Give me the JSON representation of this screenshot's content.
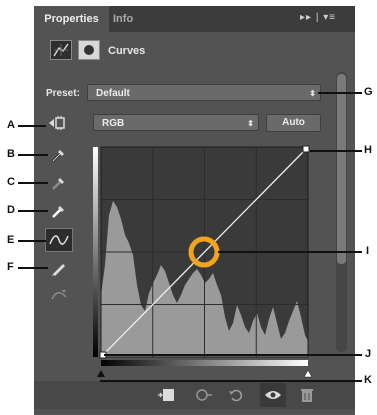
{
  "tabs": [
    {
      "label": "Properties"
    },
    {
      "label": "Info"
    }
  ],
  "panel_menu_glyph": "▸▸ | ▾≡",
  "header": {
    "title": "Curves",
    "icons": [
      "curves-adjustment-icon",
      "layer-mask-icon"
    ]
  },
  "preset": {
    "label": "Preset:",
    "value": "Default"
  },
  "channel": {
    "value": "RGB"
  },
  "auto_label": "Auto",
  "tools": [
    "on-image-adjustment-icon",
    "black-point-eyedropper-icon",
    "gray-point-eyedropper-icon",
    "white-point-eyedropper-icon",
    "point-curve-icon",
    "pencil-icon",
    "smooth-icon"
  ],
  "callouts": {
    "A": "A",
    "B": "B",
    "C": "C",
    "D": "D",
    "E": "E",
    "F": "F",
    "G": "G",
    "H": "H",
    "I": "I",
    "J": "J",
    "K": "K"
  },
  "bottom_icons": [
    "clip-to-layer-icon",
    "view-previous-state-icon",
    "reset-icon",
    "visibility-eye-icon",
    "trash-icon"
  ],
  "colors": {
    "panel": "#535353",
    "histogram": "#9a9a9a",
    "graph_bg": "#3a3a3a",
    "highlight": "#f2a51c"
  }
}
